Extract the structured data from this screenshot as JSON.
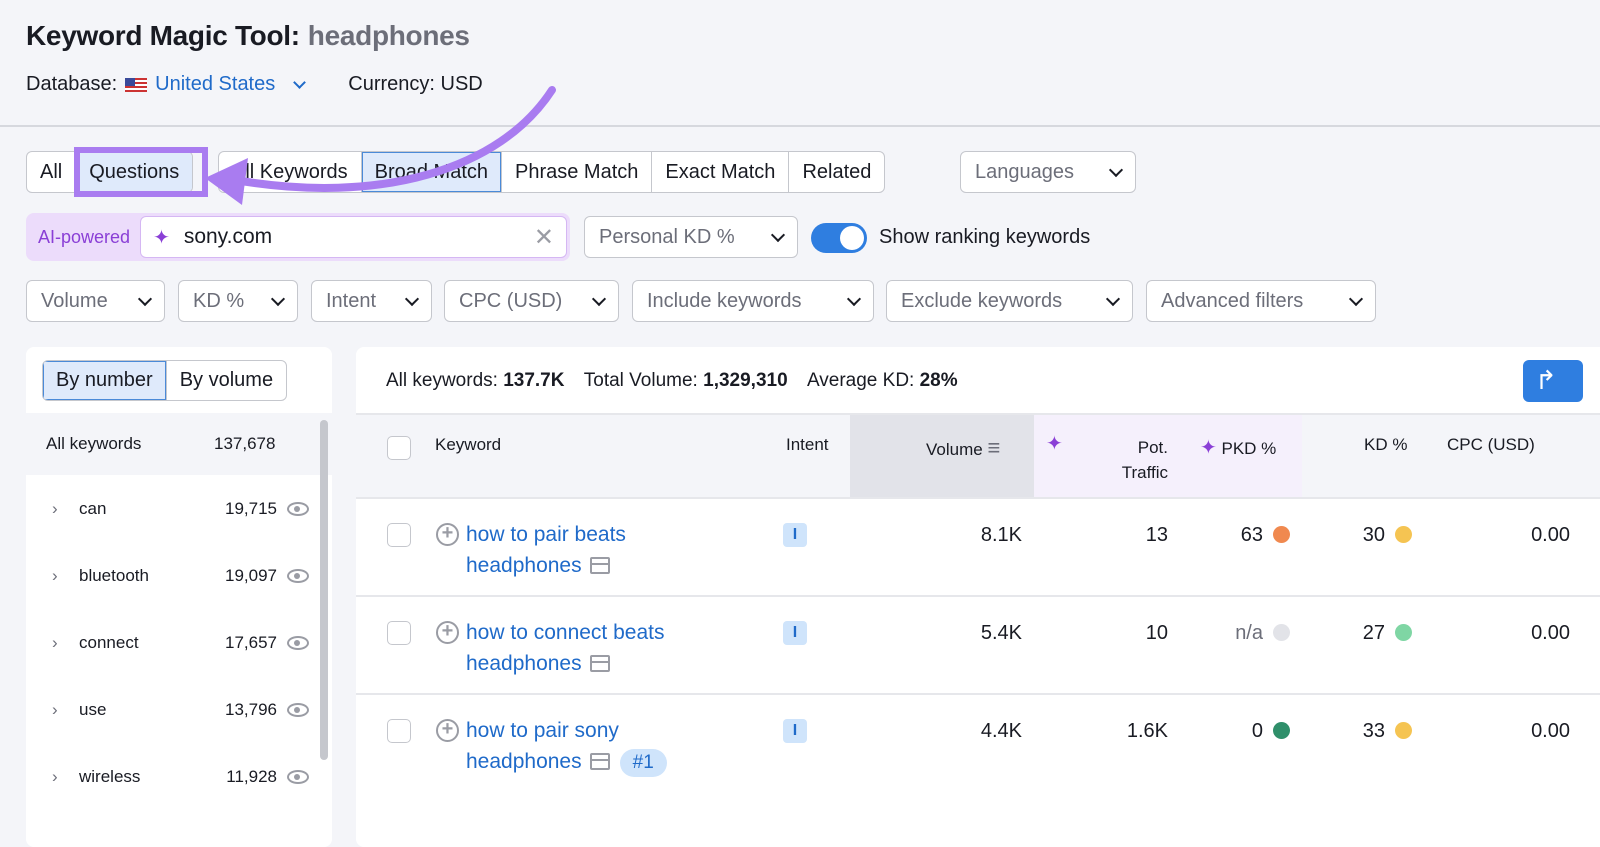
{
  "header": {
    "title": "Keyword Magic Tool:",
    "keyword": "headphones",
    "database_label": "Database:",
    "database_value": "United States",
    "currency": "Currency: USD"
  },
  "tabs_group1": [
    {
      "label": "All"
    },
    {
      "label": "Questions",
      "highlighted": true
    }
  ],
  "tabs_group2": [
    {
      "label": "All Keywords"
    },
    {
      "label": "Broad Match",
      "selected": true
    },
    {
      "label": "Phrase Match"
    },
    {
      "label": "Exact Match"
    },
    {
      "label": "Related"
    }
  ],
  "languages": "Languages",
  "ai": {
    "label": "AI-powered",
    "value": "sony.com"
  },
  "personal_kd": "Personal KD %",
  "show_ranking": {
    "label": "Show ranking keywords",
    "on": true
  },
  "filters": [
    "Volume",
    "KD %",
    "Intent",
    "CPC (USD)",
    "Include keywords",
    "Exclude keywords",
    "Advanced filters"
  ],
  "sidebar": {
    "toggle": [
      "By number",
      "By volume"
    ],
    "all_label": "All keywords",
    "all_count": "137,678",
    "items": [
      {
        "label": "can",
        "count": "19,715"
      },
      {
        "label": "bluetooth",
        "count": "19,097"
      },
      {
        "label": "connect",
        "count": "17,657"
      },
      {
        "label": "use",
        "count": "13,796"
      },
      {
        "label": "wireless",
        "count": "11,928"
      }
    ]
  },
  "summary": {
    "all_label": "All keywords:",
    "all_value": "137.7K",
    "vol_label": "Total Volume:",
    "vol_value": "1,329,310",
    "kd_label": "Average KD:",
    "kd_value": "28%"
  },
  "columns": {
    "keyword": "Keyword",
    "intent": "Intent",
    "volume": "Volume",
    "pot1": "Pot.",
    "pot2": "Traffic",
    "pkd": "PKD %",
    "kd": "KD %",
    "cpc": "CPC (USD)"
  },
  "rows": [
    {
      "l1": "how to pair beats",
      "l2": "headphones",
      "intent": "I",
      "volume": "8.1K",
      "traffic": "13",
      "pkd": "63",
      "pkd_color": "#f0894f",
      "kd": "30",
      "kd_color": "#f5c452",
      "cpc": "0.00",
      "rank": ""
    },
    {
      "l1": "how to connect beats",
      "l2": "headphones",
      "intent": "I",
      "volume": "5.4K",
      "traffic": "10",
      "pkd": "n/a",
      "pkd_color": "#e2e3e8",
      "kd": "27",
      "kd_color": "#7fd6a4",
      "cpc": "0.00",
      "rank": ""
    },
    {
      "l1": "how to pair sony",
      "l2": "headphones",
      "intent": "I",
      "volume": "4.4K",
      "traffic": "1.6K",
      "pkd": "0",
      "pkd_color": "#2f8f6a",
      "kd": "33",
      "kd_color": "#f5c452",
      "cpc": "0.00",
      "rank": "#1"
    }
  ],
  "colors": {
    "accent": "#1f6ac9",
    "annotation": "#a97cf0",
    "ai": "#8a3fd6"
  }
}
